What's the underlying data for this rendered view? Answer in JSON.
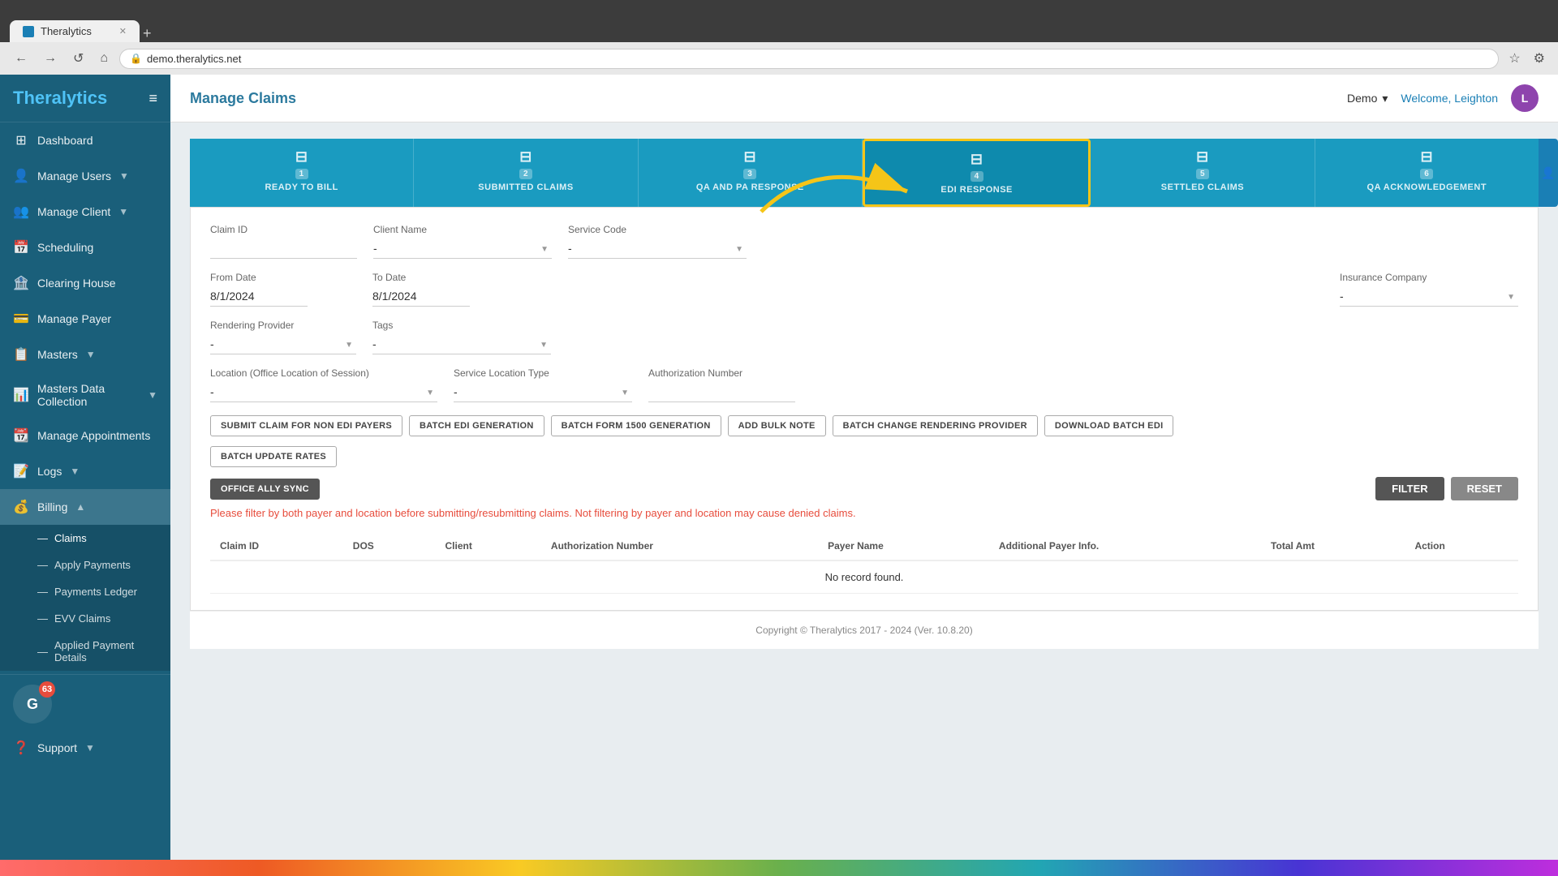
{
  "browser": {
    "tab_title": "Theralytics",
    "new_tab_label": "+",
    "address": "demo.theralytics.net",
    "nav": {
      "back": "←",
      "forward": "→",
      "reload": "↺",
      "home": "⌂"
    }
  },
  "sidebar": {
    "logo_main": "Thera",
    "logo_accent": "lytics",
    "items": [
      {
        "id": "dashboard",
        "label": "Dashboard",
        "icon": "⊞",
        "has_children": false
      },
      {
        "id": "manage-users",
        "label": "Manage Users",
        "icon": "👤",
        "has_children": true
      },
      {
        "id": "manage-client",
        "label": "Manage Client",
        "icon": "👥",
        "has_children": true
      },
      {
        "id": "scheduling",
        "label": "Scheduling",
        "icon": "📅",
        "has_children": false
      },
      {
        "id": "clearing-house",
        "label": "Clearing House",
        "icon": "🏦",
        "has_children": false
      },
      {
        "id": "manage-payer",
        "label": "Manage Payer",
        "icon": "💳",
        "has_children": false
      },
      {
        "id": "masters",
        "label": "Masters",
        "icon": "📋",
        "has_children": true
      },
      {
        "id": "masters-data-collection",
        "label": "Masters Data Collection",
        "icon": "📊",
        "has_children": true
      },
      {
        "id": "manage-appointments",
        "label": "Manage Appointments",
        "icon": "📆",
        "has_children": false
      },
      {
        "id": "logs",
        "label": "Logs",
        "icon": "📝",
        "has_children": true
      },
      {
        "id": "billing",
        "label": "Billing",
        "icon": "💰",
        "has_children": true,
        "expanded": true
      }
    ],
    "billing_sub": [
      {
        "id": "claims",
        "label": "Claims",
        "active": true
      },
      {
        "id": "apply-payments",
        "label": "Apply Payments"
      },
      {
        "id": "payments-ledger",
        "label": "Payments Ledger"
      },
      {
        "id": "evv-claims",
        "label": "EVV Claims"
      },
      {
        "id": "applied-payment-details",
        "label": "Applied Payment Details"
      }
    ],
    "bottom_items": [
      {
        "id": "support",
        "label": "Support",
        "icon": "❓",
        "has_children": true
      }
    ],
    "user_widget": {
      "initials": "G",
      "badge": "63"
    }
  },
  "header": {
    "title": "Manage Claims",
    "demo_label": "Demo",
    "welcome_text": "Welcome, Leighton",
    "user_initials": "L"
  },
  "claims": {
    "tabs": [
      {
        "id": "ready-to-bill",
        "label": "READY TO BILL",
        "num": "1",
        "icon": "⊟"
      },
      {
        "id": "submitted-claims",
        "label": "SUBMITTED CLAIMS",
        "num": "2",
        "icon": "⊟"
      },
      {
        "id": "qa-and-response",
        "label": "QA AND PA RESPONSE",
        "num": "3",
        "icon": "⊟"
      },
      {
        "id": "edi-response",
        "label": "EDI RESPONSE",
        "num": "4",
        "icon": "⊟",
        "active": true
      },
      {
        "id": "settled-claims",
        "label": "SETTLED CLAIMS",
        "num": "5",
        "icon": "⊟"
      },
      {
        "id": "qa-acknowledgement",
        "label": "QA ACKNOWLEDGEMENT",
        "num": "6",
        "icon": "⊟"
      }
    ]
  },
  "filters": {
    "claim_id_label": "Claim ID",
    "claim_id_placeholder": "",
    "client_name_label": "Client Name",
    "client_name_placeholder": "-",
    "service_code_label": "Service Code",
    "service_code_placeholder": "-",
    "from_date_label": "From Date",
    "from_date_value": "8/1/2024",
    "to_date_label": "To Date",
    "to_date_value": "8/1/2024",
    "insurance_company_label": "Insurance Company",
    "insurance_company_placeholder": "-",
    "rendering_provider_label": "Rendering Provider",
    "rendering_provider_placeholder": "-",
    "tags_label": "Tags",
    "tags_placeholder": "-",
    "location_label": "Location (Office Location of Session)",
    "location_placeholder": "-",
    "service_location_label": "Service Location Type",
    "service_location_placeholder": "-",
    "auth_number_label": "Authorization Number",
    "auth_number_placeholder": ""
  },
  "buttons": {
    "submit_claim": "SUBMIT CLAIM FOR NON EDI PAYERS",
    "batch_edi": "BATCH EDI GENERATION",
    "batch_form": "BATCH FORM 1500 GENERATION",
    "add_bulk": "ADD BULK NOTE",
    "batch_change": "BATCH CHANGE RENDERING PROVIDER",
    "download_batch": "DOWNLOAD BATCH EDI",
    "batch_update": "BATCH UPDATE RATES",
    "office_ally": "OFFICE ALLY SYNC",
    "filter": "FILTER",
    "reset": "RESET"
  },
  "warning": "Please filter by both payer and location before submitting/resubmitting claims. Not filtering by payer and location may cause denied claims.",
  "table": {
    "columns": [
      "Claim ID",
      "DOS",
      "Client",
      "Authorization Number",
      "Payer Name",
      "Additional Payer Info.",
      "Total Amt",
      "Action"
    ],
    "no_record": "No record found."
  },
  "copyright": "Copyright © Theralytics 2017 - 2024 (Ver. 10.8.20)"
}
